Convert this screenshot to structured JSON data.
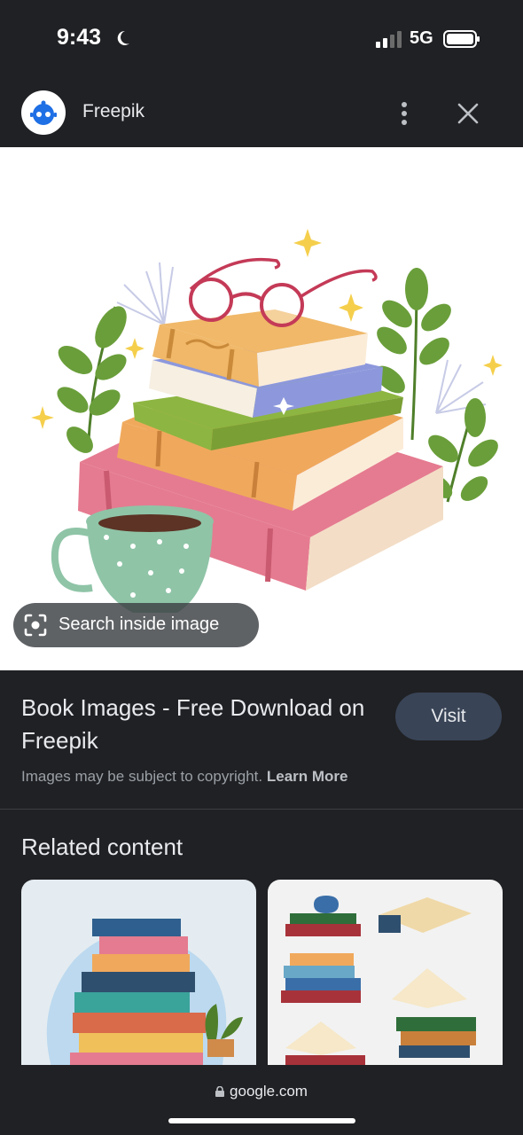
{
  "status_bar": {
    "time": "9:43",
    "network": "5G"
  },
  "top_bar": {
    "site_name": "Freepik"
  },
  "hero": {
    "search_chip_label": "Search inside image"
  },
  "result": {
    "title": "Book Images - Free Download on Freepik",
    "visit_label": "Visit",
    "copyright_text": "Images may be subject to copyright.",
    "learn_more_label": "Learn More"
  },
  "related": {
    "heading": "Related content"
  },
  "bottom_bar": {
    "url": "google.com"
  },
  "colors": {
    "background": "#202124",
    "visit_button": "#394457",
    "accent_book_pink": "#e57b90"
  }
}
